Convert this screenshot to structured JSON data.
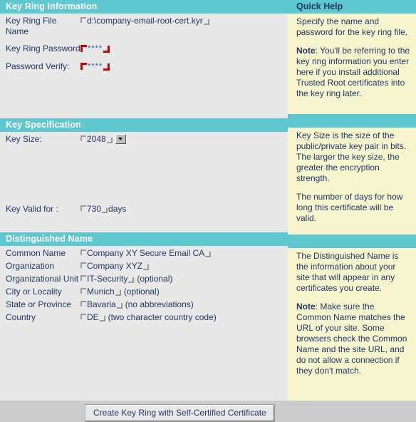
{
  "sections": {
    "key_ring_information": {
      "title": "Key Ring Information",
      "fields": {
        "file_name_label": "Key Ring File Name",
        "file_name_value": "d:\\company-email-root-cert.kyr",
        "password_label": "Key Ring Password",
        "password_value": "****",
        "password_verify_label": "Password Verify:",
        "password_verify_value": "****"
      }
    },
    "key_specification": {
      "title": "Key Specification",
      "fields": {
        "key_size_label": "Key Size:",
        "key_size_value": "2048",
        "key_valid_label": "Key Valid for :",
        "key_valid_value": "730",
        "key_valid_unit": "days"
      }
    },
    "distinguished_name": {
      "title": "Distinguished Name",
      "fields": {
        "common_name_label": "Common Name",
        "common_name_value": "Company XY Secure Email CA",
        "common_name_hint": "",
        "organization_label": "Organization",
        "organization_value": "Company XYZ",
        "organization_hint": "",
        "org_unit_label": "Organizational Unit",
        "org_unit_value": "IT-Security",
        "org_unit_hint": "(optional)",
        "city_label": "City or Locality",
        "city_value": "Munich",
        "city_hint": "(optional)",
        "state_label": "State or Province",
        "state_value": "Bavaria",
        "state_hint": "(no abbreviations)",
        "country_label": "Country",
        "country_value": "DE",
        "country_hint": "(two character country code)"
      }
    }
  },
  "quick_help": {
    "title": "Quick Help",
    "block1": {
      "p1": "Specify the name and password for the key ring file.",
      "note_label": "Note",
      "note_rest": ": You'll be referring to the key ring information you enter here if you install additional Trusted Root certificates into the key ring later."
    },
    "block2": {
      "p1": "Key Size is the size of the public/private key pair in bits. The larger the key size, the greater the encryption strength.",
      "p2": "The number of days for how long this certificate will be valid."
    },
    "block3": {
      "p1": "The Distinguished Name is the information about your site that will appear in any certificates you create.",
      "note_label": "Note",
      "note_rest": ": Make sure the Common Name matches the URL of your site. Some browsers check the Common Name and the site URL, and do not allow a connection if they don't match."
    }
  },
  "footer": {
    "create_button_label": "Create Key Ring with Self-Certified Certificate"
  },
  "colors": {
    "header_teal": "#5ec8ce",
    "help_yellow": "#f7f5cd",
    "page_gray": "#e8e8e8",
    "footer_gray": "#cccccc",
    "text_navy": "#1f3864",
    "required_red": "#cc0000"
  }
}
